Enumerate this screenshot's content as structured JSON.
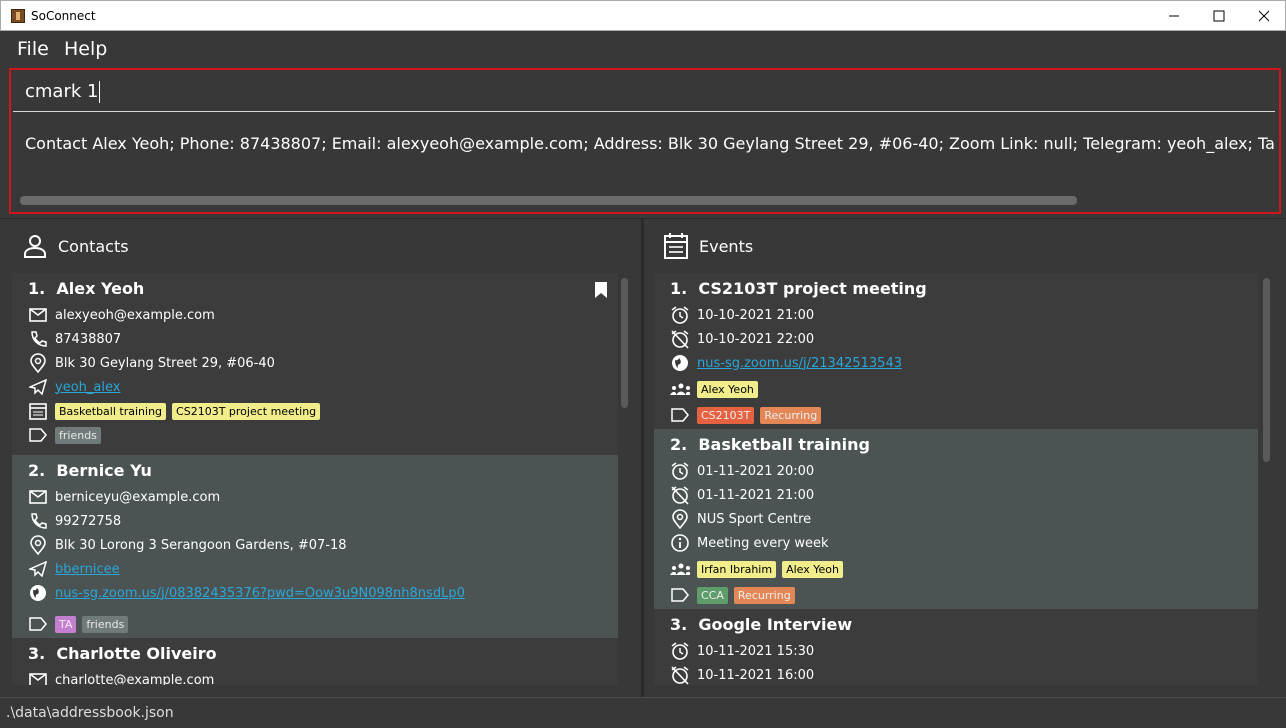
{
  "window": {
    "title": "SoConnect"
  },
  "menu": {
    "file": "File",
    "help": "Help"
  },
  "command": {
    "input_value": "cmark 1",
    "result_text": "Contact Alex Yeoh; Phone: 87438807; Email: alexyeoh@example.com; Address: Blk 30 Geylang Street 29, #06-40; Zoom Link: null; Telegram: yeoh_alex; Tags: [frie"
  },
  "contacts": {
    "header": "Contacts",
    "items": [
      {
        "index": "1.",
        "name": "Alex Yeoh",
        "email": "alexyeoh@example.com",
        "phone": "87438807",
        "address": "Blk 30 Geylang Street 29, #06-40",
        "telegram": "yeoh_alex",
        "events": [
          "Basketball training",
          "CS2103T project meeting"
        ],
        "tags": [
          "friends"
        ]
      },
      {
        "index": "2.",
        "name": "Bernice Yu",
        "email": "berniceyu@example.com",
        "phone": "99272758",
        "address": "Blk 30 Lorong 3 Serangoon Gardens, #07-18",
        "telegram": "bbernicee",
        "zoom": "nus-sg.zoom.us/j/08382435376?pwd=Oow3u9N098nh8nsdLp0",
        "tags": [
          "TA",
          "friends"
        ]
      },
      {
        "index": "3.",
        "name": "Charlotte Oliveiro",
        "email": "charlotte@example.com"
      }
    ]
  },
  "events": {
    "header": "Events",
    "items": [
      {
        "index": "1.",
        "name": "CS2103T project meeting",
        "start": "10-10-2021 21:00",
        "end": "10-10-2021 22:00",
        "zoom": "nus-sg.zoom.us/j/21342513543",
        "participants": [
          "Alex Yeoh"
        ],
        "tags": [
          "CS2103T",
          "Recurring"
        ]
      },
      {
        "index": "2.",
        "name": "Basketball training",
        "start": "01-11-2021 20:00",
        "end": "01-11-2021 21:00",
        "address": "NUS Sport Centre",
        "description": "Meeting every week",
        "participants": [
          "Irfan Ibrahim",
          "Alex Yeoh"
        ],
        "tags": [
          "CCA",
          "Recurring"
        ]
      },
      {
        "index": "3.",
        "name": "Google Interview",
        "start": "10-11-2021 15:30",
        "end": "10-11-2021 16:00"
      }
    ]
  },
  "status": {
    "path": ".\\data\\addressbook.json"
  },
  "colors": {
    "accent_border": "#d0161b",
    "link": "#2aa7d8",
    "tag_yellow": "#f0ed8a"
  }
}
